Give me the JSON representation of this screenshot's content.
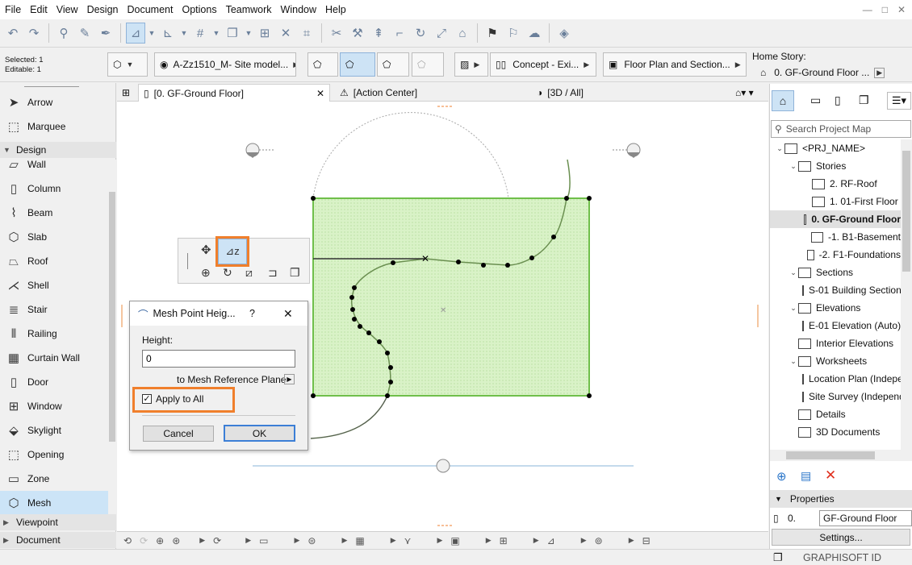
{
  "menu": [
    "File",
    "Edit",
    "View",
    "Design",
    "Document",
    "Options",
    "Teamwork",
    "Window",
    "Help"
  ],
  "window_controls": [
    "—",
    "□",
    "✕"
  ],
  "info": {
    "selected": "Selected: 1",
    "editable": "Editable: 1",
    "layer": "A-Zz1510_M- Site model...",
    "surface": "Concept - Exi...",
    "view": "Floor Plan and Section...",
    "home_story_label": "Home Story:",
    "home_story": "0. GF-Ground Floor ..."
  },
  "toolbox": {
    "items_top": [
      {
        "label": "Arrow",
        "icon": "arrow-icon"
      },
      {
        "label": "Marquee",
        "icon": "marquee-icon"
      }
    ],
    "design_group": "Design",
    "items": [
      {
        "label": "Wall"
      },
      {
        "label": "Column"
      },
      {
        "label": "Beam"
      },
      {
        "label": "Slab"
      },
      {
        "label": "Roof"
      },
      {
        "label": "Shell"
      },
      {
        "label": "Stair"
      },
      {
        "label": "Railing"
      },
      {
        "label": "Curtain Wall"
      },
      {
        "label": "Door"
      },
      {
        "label": "Window"
      },
      {
        "label": "Skylight"
      },
      {
        "label": "Opening"
      },
      {
        "label": "Zone"
      },
      {
        "label": "Mesh"
      }
    ],
    "viewpoint_group": "Viewpoint",
    "document_group": "Document"
  },
  "tabs": [
    {
      "label": "[0. GF-Ground Floor]",
      "close": "✕"
    },
    {
      "label": "[Action Center]"
    },
    {
      "label": "[3D / All]"
    }
  ],
  "dialog": {
    "title": "Mesh Point Heig...",
    "help": "?",
    "close": "✕",
    "height_label": "Height:",
    "height_value": "0",
    "ref_label": "to Mesh Reference Plane",
    "apply_label": "Apply to All",
    "cancel": "Cancel",
    "ok": "OK"
  },
  "project_map": {
    "search_placeholder": "Search Project Map",
    "items": [
      {
        "label": "<PRJ_NAME>",
        "level": 0,
        "exp": "v"
      },
      {
        "label": "Stories",
        "level": 1,
        "exp": "v"
      },
      {
        "label": "2. RF-Roof",
        "level": 2
      },
      {
        "label": "1. 01-First Floor",
        "level": 2
      },
      {
        "label": "0. GF-Ground Floor",
        "level": 2,
        "selected": true
      },
      {
        "label": "-1. B1-Basement",
        "level": 2
      },
      {
        "label": "-2. F1-Foundations",
        "level": 2
      },
      {
        "label": "Sections",
        "level": 1,
        "exp": "v"
      },
      {
        "label": "S-01 Building Section",
        "level": 2
      },
      {
        "label": "Elevations",
        "level": 1,
        "exp": "v"
      },
      {
        "label": "E-01 Elevation (Auto)",
        "level": 2
      },
      {
        "label": "Interior Elevations",
        "level": 1
      },
      {
        "label": "Worksheets",
        "level": 1,
        "exp": "v"
      },
      {
        "label": "Location Plan (Independent)",
        "level": 2
      },
      {
        "label": "Site Survey (Independent)",
        "level": 2
      },
      {
        "label": "Details",
        "level": 1
      },
      {
        "label": "3D Documents",
        "level": 1
      }
    ]
  },
  "properties": {
    "title": "Properties",
    "story_num": "0.",
    "story_name": "GF-Ground Floor",
    "settings": "Settings..."
  },
  "status": {
    "brand": "GRAPHISOFT ID"
  },
  "colors": {
    "accent": "#f07f2c",
    "mesh_fill": "#d6f0c2",
    "mesh_stroke": "#6fbf4a",
    "selection": "#cce4f7"
  }
}
